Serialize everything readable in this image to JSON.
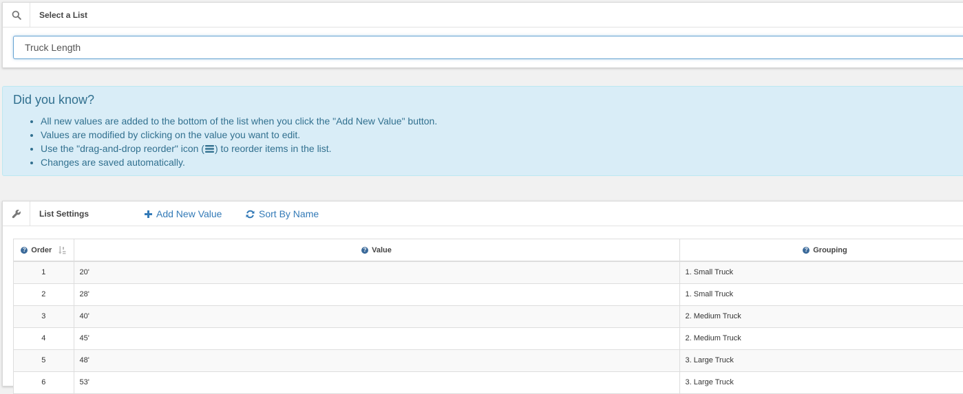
{
  "select_panel": {
    "title": "Select a List",
    "input_value": "Truck Length"
  },
  "info": {
    "heading": "Did you know?",
    "tip1": "All new values are added to the bottom of the list when you click the \"Add New Value\" button.",
    "tip2": "Values are modified by clicking on the value you want to edit.",
    "tip3_before": "Use the \"drag-and-drop reorder\" icon (",
    "tip3_after": ") to reorder items in the list.",
    "tip4": "Changes are saved automatically."
  },
  "settings_panel": {
    "title": "List Settings",
    "add_label": "Add New Value",
    "sort_label": "Sort By Name"
  },
  "table": {
    "headers": {
      "order": "Order",
      "value": "Value",
      "grouping": "Grouping"
    },
    "rows": [
      {
        "order": "1",
        "value": "20'",
        "grouping": "1. Small Truck"
      },
      {
        "order": "2",
        "value": "28'",
        "grouping": "1. Small Truck"
      },
      {
        "order": "3",
        "value": "40'",
        "grouping": "2. Medium Truck"
      },
      {
        "order": "4",
        "value": "45'",
        "grouping": "2. Medium Truck"
      },
      {
        "order": "5",
        "value": "48'",
        "grouping": "3. Large Truck"
      },
      {
        "order": "6",
        "value": "53'",
        "grouping": "3. Large Truck"
      }
    ]
  },
  "colors": {
    "accent": "#337ab7",
    "info_bg": "#d9edf7",
    "info_text": "#31708f"
  },
  "icons": {
    "search": "search-icon",
    "wrench": "wrench-icon",
    "plus": "plus-icon",
    "refresh": "refresh-icon",
    "question": "question-circle-icon",
    "sort": "sort-icon",
    "reorder": "bars-icon"
  }
}
